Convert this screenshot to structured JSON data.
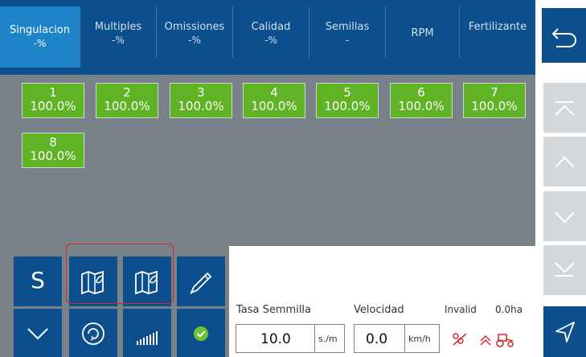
{
  "tabs": [
    {
      "label": "Singulacion",
      "sub": "-%",
      "active": true
    },
    {
      "label": "Multiples",
      "sub": "-%",
      "active": false
    },
    {
      "label": "Omissiones",
      "sub": "-%",
      "active": false
    },
    {
      "label": "Calidad",
      "sub": "-%",
      "active": false
    },
    {
      "label": "Semillas",
      "sub": "-",
      "active": false
    },
    {
      "label": "RPM",
      "sub": "",
      "active": false
    },
    {
      "label": "Fertilizante",
      "sub": "",
      "active": false
    }
  ],
  "rows": [
    {
      "num": "1",
      "value": "100.0%"
    },
    {
      "num": "2",
      "value": "100.0%"
    },
    {
      "num": "3",
      "value": "100.0%"
    },
    {
      "num": "4",
      "value": "100.0%"
    },
    {
      "num": "5",
      "value": "100.0%"
    },
    {
      "num": "6",
      "value": "100.0%"
    },
    {
      "num": "7",
      "value": "100.0%"
    },
    {
      "num": "8",
      "value": "100.0%"
    }
  ],
  "toolbar": {
    "s_label": "S"
  },
  "footer": {
    "seed_rate_label": "Tasa Semmilla",
    "seed_rate_value": "10.0",
    "seed_rate_unit": "s./m",
    "speed_label": "Velocidad",
    "speed_value": "0.0",
    "speed_unit": "km/h",
    "status": "Invalid",
    "area": "0.0ha"
  },
  "colors": {
    "primary": "#0d4f8c",
    "active_tab": "#1d84c7",
    "cell_green": "#5fb324",
    "background_grey": "#7a8289",
    "alert_red": "#d9262b"
  },
  "icons": [
    "back-arrow-icon",
    "scroll-top-icon",
    "scroll-up-icon",
    "scroll-down-icon",
    "scroll-bottom-icon",
    "map-leaf-icon",
    "map-icon",
    "pencil-icon",
    "chevron-down-icon",
    "refresh-icon",
    "signal-bars-icon",
    "check-icon",
    "seed-off-icon",
    "tractor-icon",
    "navigation-icon"
  ]
}
